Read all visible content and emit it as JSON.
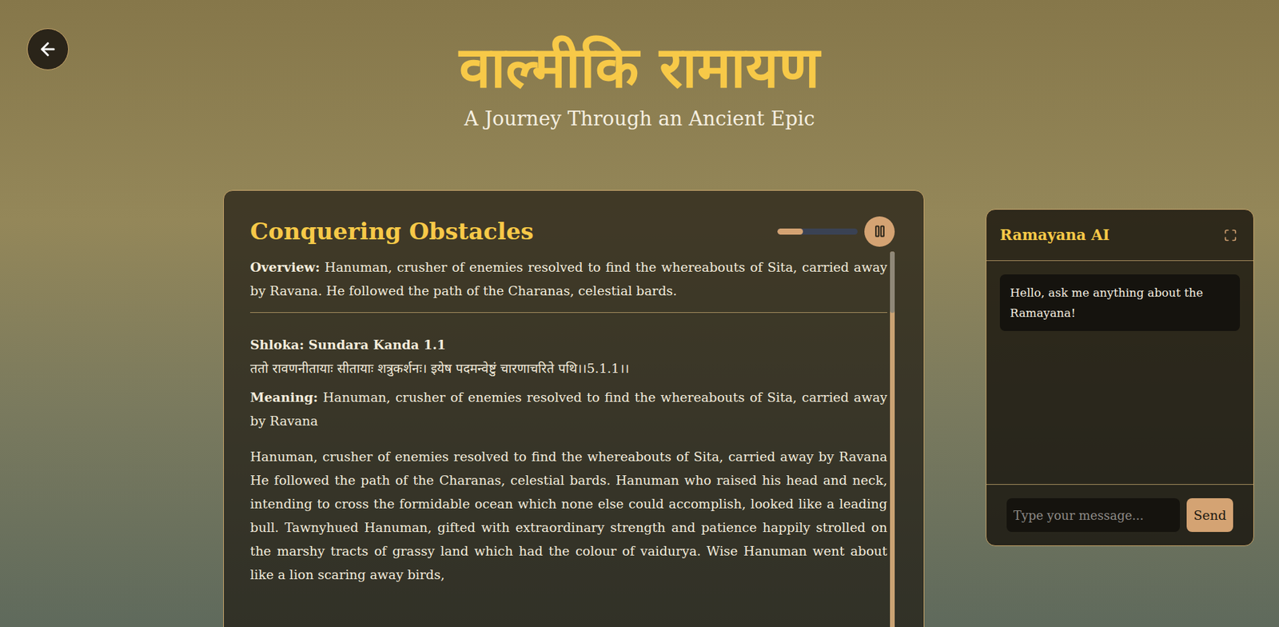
{
  "page": {
    "title": "वाल्मीकि रामायण",
    "subtitle": "A Journey Through an Ancient Epic"
  },
  "chapter": {
    "title": "Conquering Obstacles",
    "audio": {
      "level": 0.32,
      "playing": true
    },
    "overview_label": "Overview:",
    "overview": "Hanuman, crusher of enemies resolved to find the whereabouts of Sita, carried away by Ravana. He followed the path of the Charanas, celestial bards.",
    "shloka_heading": "Shloka: Sundara Kanda 1.1",
    "shloka": "ततो रावणनीतायाः सीतायाः शत्रुकर्शनः। इयेष पदमन्वेष्टुं चारणाचरिते पथि।।5.1.1।।",
    "meaning_label": "Meaning:",
    "meaning": "Hanuman, crusher of enemies resolved to find the whereabouts of Sita, carried away by Ravana",
    "paragraph": "Hanuman, crusher of enemies resolved to find the whereabouts of Sita, carried away by Ravana He followed the path of the Charanas, celestial bards. Hanuman who raised his head and neck, intending to cross the formidable ocean which none else could accomplish, looked like a leading bull. Tawnyhued Hanuman, gifted with extraordinary strength and patience happily strolled on the marshy tracts of grassy land which had the colour of vaidurya. Wise Hanuman went about like a lion scaring away birds,",
    "scroll": {
      "level": 0.15
    }
  },
  "chat": {
    "title": "Ramayana AI",
    "messages": [
      {
        "from": "bot",
        "text": "Hello, ask me anything about the Ramayana!"
      }
    ],
    "input": {
      "placeholder": "Type your message..."
    },
    "send": "Send"
  }
}
